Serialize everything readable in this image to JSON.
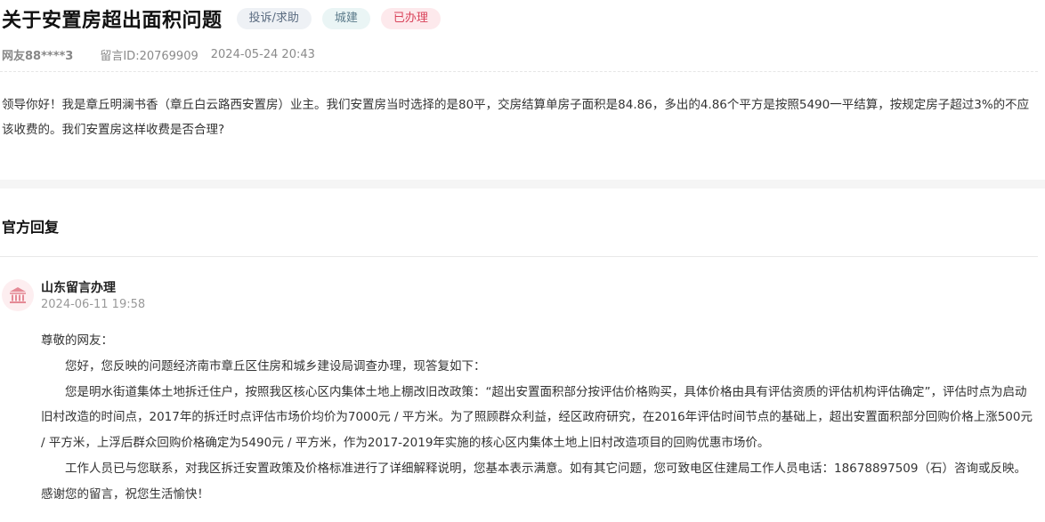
{
  "question": {
    "title": "关于安置房超出面积问题",
    "tags": {
      "type": "投诉/求助",
      "department": "城建",
      "status": "已办理"
    },
    "meta": {
      "user": "网友88****3",
      "message_id": "留言ID:20769909",
      "datetime": "2024-05-24 20:43"
    },
    "content": "领导你好！我是章丘明澜书香（章丘白云路西安置房）业主。我们安置房当时选择的是80平，交房结算单房子面积是84.86，多出的4.86个平方是按照5490一平结算，按规定房子超过3%的不应该收费的。我们安置房这样收费是否合理?"
  },
  "reply": {
    "section_title": "官方回复",
    "avatar_icon": "government-building-icon",
    "organization": "山东留言办理",
    "datetime": "2024-06-11 19:58",
    "greeting": "尊敬的网友：",
    "paragraphs": [
      "您好，您反映的问题经济南市章丘区住房和城乡建设局调查办理，现答复如下：",
      "您是明水街道集体土地拆迁住户，按照我区核心区内集体土地上棚改旧改政策：“超出安置面积部分按评估价格购买，具体价格由具有评估资质的评估机构评估确定”，评估时点为启动旧村改造的时间点，2017年的拆迁时点评估市场价均价为7000元 / 平方米。为了照顾群众利益，经区政府研究，在2016年评估时间节点的基础上，超出安置面积部分回购价格上涨500元 / 平方米，上浮后群众回购价格确定为5490元 / 平方米，作为2017-2019年实施的核心区内集体土地上旧村改造项目的回购优惠市场价。",
      "工作人员已与您联系，对我区拆迁安置政策及价格标准进行了详细解释说明，您基本表示满意。如有其它问题，您可致电区住建局工作人员电话：18678897509（石）咨询或反映。感谢您的留言，祝您生活愉快！"
    ]
  },
  "colors": {
    "status_tag_text": "#d9435a",
    "status_tag_bg": "#fde9ec",
    "avatar_icon": "#e58a96"
  }
}
